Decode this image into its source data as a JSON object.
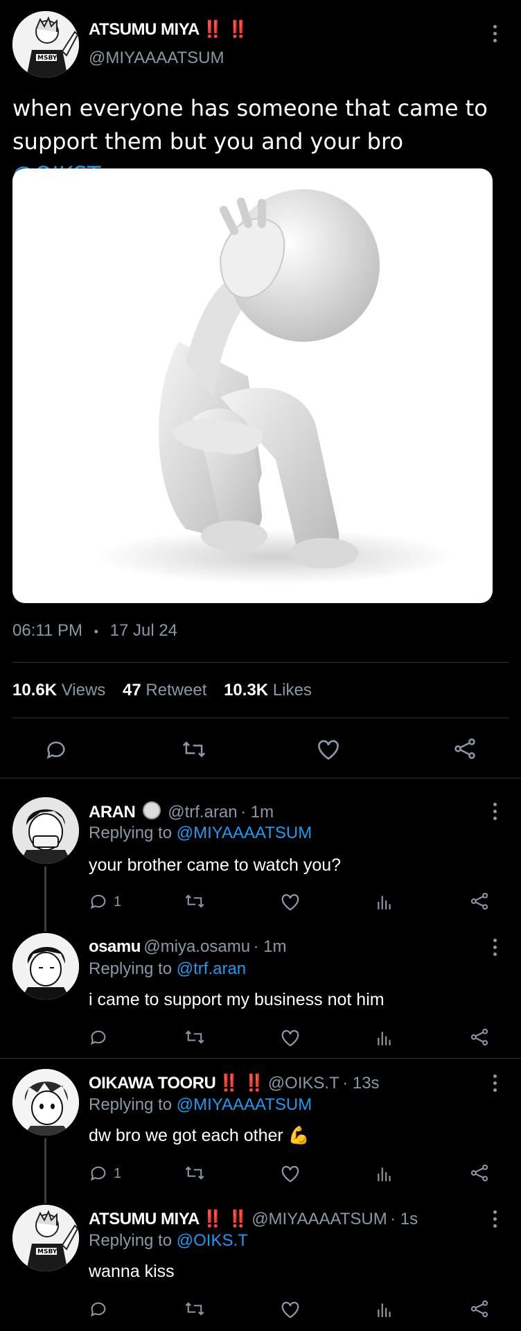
{
  "tweet": {
    "author_name": "ATSUMU MIYA",
    "author_bangs": "‼️ ‼️",
    "author_handle": "@MIYAAAATSUM",
    "text": "when everyone has someone that came to support them but you and your bro",
    "mention": "@OIKST",
    "time": "06:11 PM",
    "date": "17 Jul 24",
    "separator": "•",
    "stats": {
      "views_count": "10.6K",
      "views_label": "Views",
      "retweets_count": "47",
      "retweets_label": "Retweet",
      "likes_count": "10.3K",
      "likes_label": "Likes"
    }
  },
  "replies": [
    {
      "name": "ARAN",
      "bangs": "",
      "handle": "@trf.aran",
      "time": "· 1m",
      "replying_prefix": "Replying to",
      "replying_to": "@MIYAAAATSUM",
      "text": "your brother came to watch you?",
      "reply_count": "1"
    },
    {
      "name": "osamu",
      "bangs": "",
      "handle": "@miya.osamu",
      "time": "· 1m",
      "replying_prefix": "Replying to",
      "replying_to": "@trf.aran",
      "text": "i came to support my business not him",
      "reply_count": ""
    },
    {
      "name": "OIKAWA TOORU",
      "bangs": "‼️ ‼️",
      "handle": "@OIKS.T",
      "time": "· 13s",
      "replying_prefix": "Replying to",
      "replying_to": "@MIYAAAATSUM",
      "text": "dw bro we got each other 💪",
      "reply_count": "1"
    },
    {
      "name": "ATSUMU MIYA",
      "bangs": "‼️ ‼️",
      "handle": "@MIYAAAATSUM",
      "time": "· 1s",
      "replying_prefix": "Replying to",
      "replying_to": "@OIKS.T",
      "text": "wanna kiss",
      "reply_count": ""
    }
  ],
  "colors": {
    "background": "#000000",
    "link": "#1d9bf0",
    "muted": "#8b98a5",
    "bangs": "#e0243a",
    "divider": "#2f3336"
  }
}
